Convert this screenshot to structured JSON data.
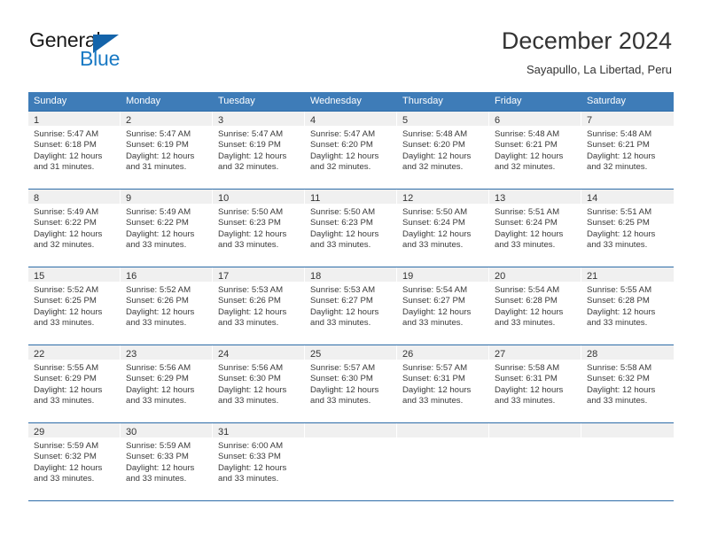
{
  "logo": {
    "word1": "General",
    "word2": "Blue",
    "triangle_color": "#1464aa",
    "word2_color": "#1a7ac4",
    "icon": "blue-triangle-logo"
  },
  "header": {
    "title": "December 2024",
    "subtitle": "Sayapullo, La Libertad, Peru"
  },
  "theme": {
    "header_band": "#3e7cb8",
    "row_rule": "#2d6ca8",
    "daynum_band": "#f0f0f0",
    "text": "#333333"
  },
  "calendar": {
    "day_names": [
      "Sunday",
      "Monday",
      "Tuesday",
      "Wednesday",
      "Thursday",
      "Friday",
      "Saturday"
    ],
    "labels": {
      "sunrise": "Sunrise:",
      "sunset": "Sunset:",
      "daylight": "Daylight:"
    },
    "weeks": [
      [
        {
          "day": "1",
          "sunrise": "Sunrise: 5:47 AM",
          "sunset": "Sunset: 6:18 PM",
          "daylight_line1": "Daylight: 12 hours",
          "daylight_line2": "and 31 minutes."
        },
        {
          "day": "2",
          "sunrise": "Sunrise: 5:47 AM",
          "sunset": "Sunset: 6:19 PM",
          "daylight_line1": "Daylight: 12 hours",
          "daylight_line2": "and 31 minutes."
        },
        {
          "day": "3",
          "sunrise": "Sunrise: 5:47 AM",
          "sunset": "Sunset: 6:19 PM",
          "daylight_line1": "Daylight: 12 hours",
          "daylight_line2": "and 32 minutes."
        },
        {
          "day": "4",
          "sunrise": "Sunrise: 5:47 AM",
          "sunset": "Sunset: 6:20 PM",
          "daylight_line1": "Daylight: 12 hours",
          "daylight_line2": "and 32 minutes."
        },
        {
          "day": "5",
          "sunrise": "Sunrise: 5:48 AM",
          "sunset": "Sunset: 6:20 PM",
          "daylight_line1": "Daylight: 12 hours",
          "daylight_line2": "and 32 minutes."
        },
        {
          "day": "6",
          "sunrise": "Sunrise: 5:48 AM",
          "sunset": "Sunset: 6:21 PM",
          "daylight_line1": "Daylight: 12 hours",
          "daylight_line2": "and 32 minutes."
        },
        {
          "day": "7",
          "sunrise": "Sunrise: 5:48 AM",
          "sunset": "Sunset: 6:21 PM",
          "daylight_line1": "Daylight: 12 hours",
          "daylight_line2": "and 32 minutes."
        }
      ],
      [
        {
          "day": "8",
          "sunrise": "Sunrise: 5:49 AM",
          "sunset": "Sunset: 6:22 PM",
          "daylight_line1": "Daylight: 12 hours",
          "daylight_line2": "and 32 minutes."
        },
        {
          "day": "9",
          "sunrise": "Sunrise: 5:49 AM",
          "sunset": "Sunset: 6:22 PM",
          "daylight_line1": "Daylight: 12 hours",
          "daylight_line2": "and 33 minutes."
        },
        {
          "day": "10",
          "sunrise": "Sunrise: 5:50 AM",
          "sunset": "Sunset: 6:23 PM",
          "daylight_line1": "Daylight: 12 hours",
          "daylight_line2": "and 33 minutes."
        },
        {
          "day": "11",
          "sunrise": "Sunrise: 5:50 AM",
          "sunset": "Sunset: 6:23 PM",
          "daylight_line1": "Daylight: 12 hours",
          "daylight_line2": "and 33 minutes."
        },
        {
          "day": "12",
          "sunrise": "Sunrise: 5:50 AM",
          "sunset": "Sunset: 6:24 PM",
          "daylight_line1": "Daylight: 12 hours",
          "daylight_line2": "and 33 minutes."
        },
        {
          "day": "13",
          "sunrise": "Sunrise: 5:51 AM",
          "sunset": "Sunset: 6:24 PM",
          "daylight_line1": "Daylight: 12 hours",
          "daylight_line2": "and 33 minutes."
        },
        {
          "day": "14",
          "sunrise": "Sunrise: 5:51 AM",
          "sunset": "Sunset: 6:25 PM",
          "daylight_line1": "Daylight: 12 hours",
          "daylight_line2": "and 33 minutes."
        }
      ],
      [
        {
          "day": "15",
          "sunrise": "Sunrise: 5:52 AM",
          "sunset": "Sunset: 6:25 PM",
          "daylight_line1": "Daylight: 12 hours",
          "daylight_line2": "and 33 minutes."
        },
        {
          "day": "16",
          "sunrise": "Sunrise: 5:52 AM",
          "sunset": "Sunset: 6:26 PM",
          "daylight_line1": "Daylight: 12 hours",
          "daylight_line2": "and 33 minutes."
        },
        {
          "day": "17",
          "sunrise": "Sunrise: 5:53 AM",
          "sunset": "Sunset: 6:26 PM",
          "daylight_line1": "Daylight: 12 hours",
          "daylight_line2": "and 33 minutes."
        },
        {
          "day": "18",
          "sunrise": "Sunrise: 5:53 AM",
          "sunset": "Sunset: 6:27 PM",
          "daylight_line1": "Daylight: 12 hours",
          "daylight_line2": "and 33 minutes."
        },
        {
          "day": "19",
          "sunrise": "Sunrise: 5:54 AM",
          "sunset": "Sunset: 6:27 PM",
          "daylight_line1": "Daylight: 12 hours",
          "daylight_line2": "and 33 minutes."
        },
        {
          "day": "20",
          "sunrise": "Sunrise: 5:54 AM",
          "sunset": "Sunset: 6:28 PM",
          "daylight_line1": "Daylight: 12 hours",
          "daylight_line2": "and 33 minutes."
        },
        {
          "day": "21",
          "sunrise": "Sunrise: 5:55 AM",
          "sunset": "Sunset: 6:28 PM",
          "daylight_line1": "Daylight: 12 hours",
          "daylight_line2": "and 33 minutes."
        }
      ],
      [
        {
          "day": "22",
          "sunrise": "Sunrise: 5:55 AM",
          "sunset": "Sunset: 6:29 PM",
          "daylight_line1": "Daylight: 12 hours",
          "daylight_line2": "and 33 minutes."
        },
        {
          "day": "23",
          "sunrise": "Sunrise: 5:56 AM",
          "sunset": "Sunset: 6:29 PM",
          "daylight_line1": "Daylight: 12 hours",
          "daylight_line2": "and 33 minutes."
        },
        {
          "day": "24",
          "sunrise": "Sunrise: 5:56 AM",
          "sunset": "Sunset: 6:30 PM",
          "daylight_line1": "Daylight: 12 hours",
          "daylight_line2": "and 33 minutes."
        },
        {
          "day": "25",
          "sunrise": "Sunrise: 5:57 AM",
          "sunset": "Sunset: 6:30 PM",
          "daylight_line1": "Daylight: 12 hours",
          "daylight_line2": "and 33 minutes."
        },
        {
          "day": "26",
          "sunrise": "Sunrise: 5:57 AM",
          "sunset": "Sunset: 6:31 PM",
          "daylight_line1": "Daylight: 12 hours",
          "daylight_line2": "and 33 minutes."
        },
        {
          "day": "27",
          "sunrise": "Sunrise: 5:58 AM",
          "sunset": "Sunset: 6:31 PM",
          "daylight_line1": "Daylight: 12 hours",
          "daylight_line2": "and 33 minutes."
        },
        {
          "day": "28",
          "sunrise": "Sunrise: 5:58 AM",
          "sunset": "Sunset: 6:32 PM",
          "daylight_line1": "Daylight: 12 hours",
          "daylight_line2": "and 33 minutes."
        }
      ],
      [
        {
          "day": "29",
          "sunrise": "Sunrise: 5:59 AM",
          "sunset": "Sunset: 6:32 PM",
          "daylight_line1": "Daylight: 12 hours",
          "daylight_line2": "and 33 minutes."
        },
        {
          "day": "30",
          "sunrise": "Sunrise: 5:59 AM",
          "sunset": "Sunset: 6:33 PM",
          "daylight_line1": "Daylight: 12 hours",
          "daylight_line2": "and 33 minutes."
        },
        {
          "day": "31",
          "sunrise": "Sunrise: 6:00 AM",
          "sunset": "Sunset: 6:33 PM",
          "daylight_line1": "Daylight: 12 hours",
          "daylight_line2": "and 33 minutes."
        },
        {
          "day": "",
          "sunrise": "",
          "sunset": "",
          "daylight_line1": "",
          "daylight_line2": ""
        },
        {
          "day": "",
          "sunrise": "",
          "sunset": "",
          "daylight_line1": "",
          "daylight_line2": ""
        },
        {
          "day": "",
          "sunrise": "",
          "sunset": "",
          "daylight_line1": "",
          "daylight_line2": ""
        },
        {
          "day": "",
          "sunrise": "",
          "sunset": "",
          "daylight_line1": "",
          "daylight_line2": ""
        }
      ]
    ]
  }
}
